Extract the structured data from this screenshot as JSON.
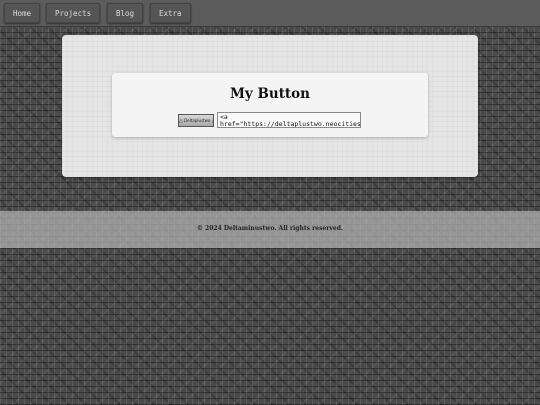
{
  "nav": {
    "items": [
      {
        "label": "Home"
      },
      {
        "label": "Projects"
      },
      {
        "label": "Blog"
      },
      {
        "label": "Extra"
      }
    ]
  },
  "main": {
    "title": "My Button",
    "badge": {
      "label": "Deltaplustwo",
      "icon": "triangle-icon"
    },
    "code": "<a\nhref=\"https://deltaplustwo.neocities.org/"
  },
  "footer": {
    "text": "© 2024 Deltaminustwo. All rights reserved."
  },
  "colors": {
    "background": "#4a4a4a",
    "panel": "#e5e5e5",
    "card": "#f4f4f4",
    "footer_band": "#b4b4b4"
  }
}
